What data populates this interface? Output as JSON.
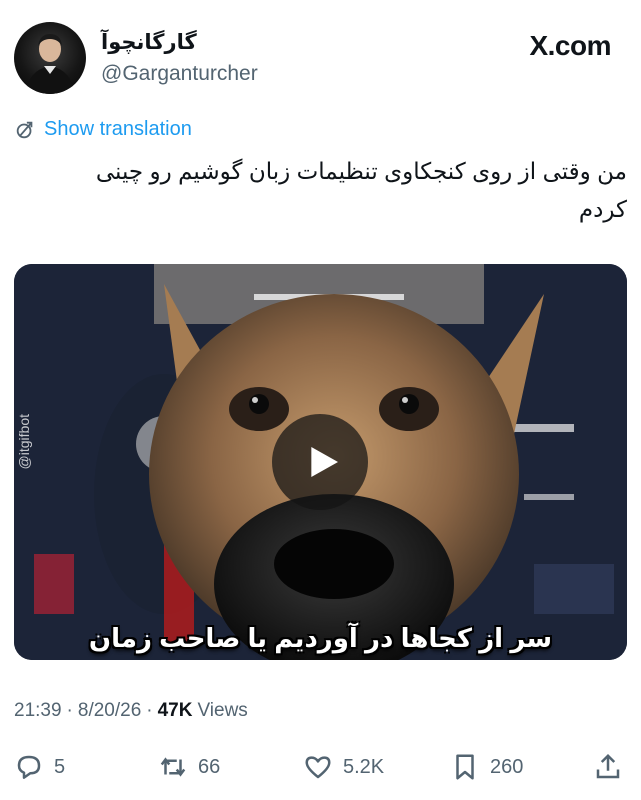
{
  "author": {
    "display_name": "گارگانچوآ",
    "handle": "@Garganturcher",
    "avatar_icon": "profile-photo"
  },
  "site": {
    "logo_text": "X.com"
  },
  "translation": {
    "label": "Show translation",
    "icon": "translate-icon",
    "color": "#1d9bf0"
  },
  "tweet": {
    "text_line1": "من وقتی از روی کنجکاوی تنظیمات زبان گوشیم رو چینی",
    "text_line2": "کردم"
  },
  "media": {
    "watermark": "@itgifbot",
    "caption": "سر از کجاها در آوردیم یا صاحب زمان",
    "play_icon": "play-icon"
  },
  "meta": {
    "time": "21:39",
    "date": "8/20/26",
    "separator": "·",
    "views_count": "47K",
    "views_label": "Views"
  },
  "actions": {
    "replies": "5",
    "reposts": "66",
    "likes": "5.2K",
    "bookmarks": "260"
  },
  "colors": {
    "text": "#0f1419",
    "secondary": "#536471",
    "accent": "#1d9bf0"
  }
}
